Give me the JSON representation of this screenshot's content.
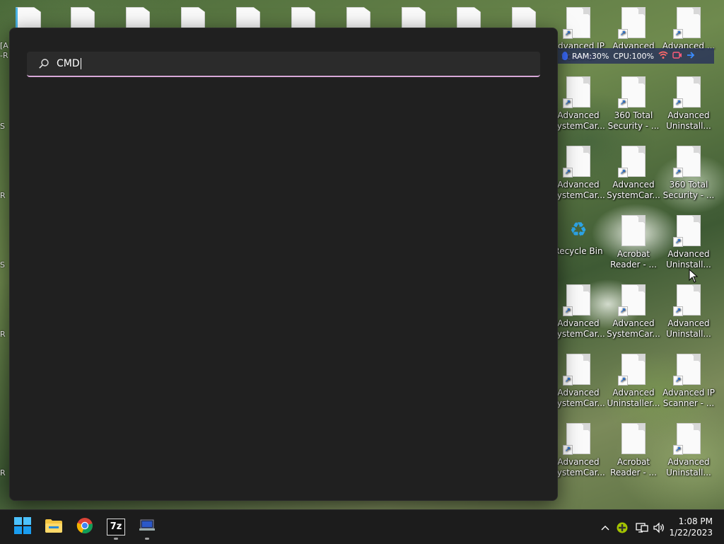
{
  "desktop": {
    "left_column_fragments": [
      "[A",
      "-R",
      "S",
      "R",
      "S",
      "R",
      "R"
    ],
    "icons_col1": [
      {
        "label": "Advanced IP Scanner",
        "kind": "shortcut"
      },
      {
        "label": "Advanced SystemCar...",
        "kind": "shortcut"
      },
      {
        "label": "Advanced SystemCar...",
        "kind": "shortcut"
      },
      {
        "label": "Recycle Bin",
        "kind": "recycle"
      },
      {
        "label": "Advanced SystemCar...",
        "kind": "shortcut"
      },
      {
        "label": "Advanced SystemCar...",
        "kind": "shortcut"
      },
      {
        "label": "Advanced SystemCar...",
        "kind": "shortcut"
      }
    ],
    "icons_col2": [
      {
        "label": "Advanced",
        "kind": "shortcut"
      },
      {
        "label": "360 Total Security - ...",
        "kind": "shortcut"
      },
      {
        "label": "Advanced SystemCar...",
        "kind": "shortcut"
      },
      {
        "label": "Acrobat Reader - ...",
        "kind": "file"
      },
      {
        "label": "Advanced SystemCar...",
        "kind": "shortcut"
      },
      {
        "label": "Advanced Uninstaller...",
        "kind": "shortcut"
      },
      {
        "label": "Acrobat Reader - ...",
        "kind": "file"
      }
    ],
    "icons_col3": [
      {
        "label": "Advanced ...",
        "kind": "shortcut"
      },
      {
        "label": "Advanced Uninstall...",
        "kind": "shortcut"
      },
      {
        "label": "360 Total Security - ...",
        "kind": "shortcut"
      },
      {
        "label": "Advanced Uninstall...",
        "kind": "shortcut"
      },
      {
        "label": "Advanced Uninstall...",
        "kind": "shortcut"
      },
      {
        "label": "Advanced IP Scanner - ...",
        "kind": "shortcut"
      },
      {
        "label": "Advanced Uninstall...",
        "kind": "shortcut"
      }
    ]
  },
  "perf_monitor": {
    "ram_label": "RAM:30%",
    "cpu_label": "CPU:100%"
  },
  "search": {
    "query": "CMD",
    "accent_color": "#d8a8d8"
  },
  "taskbar": {
    "apps": [
      {
        "name": "Start",
        "icon": "windows-start-icon",
        "active": false
      },
      {
        "name": "File Explorer",
        "icon": "file-explorer-icon",
        "active": false
      },
      {
        "name": "Google Chrome",
        "icon": "chrome-icon",
        "active": false
      },
      {
        "name": "7-Zip",
        "icon": "7zip-icon",
        "active": true
      },
      {
        "name": "App",
        "icon": "laptop-app-icon",
        "active": true
      }
    ],
    "sevenzip_label": "7z",
    "clock": {
      "time": "1:08 PM",
      "date": "1/22/2023"
    }
  }
}
